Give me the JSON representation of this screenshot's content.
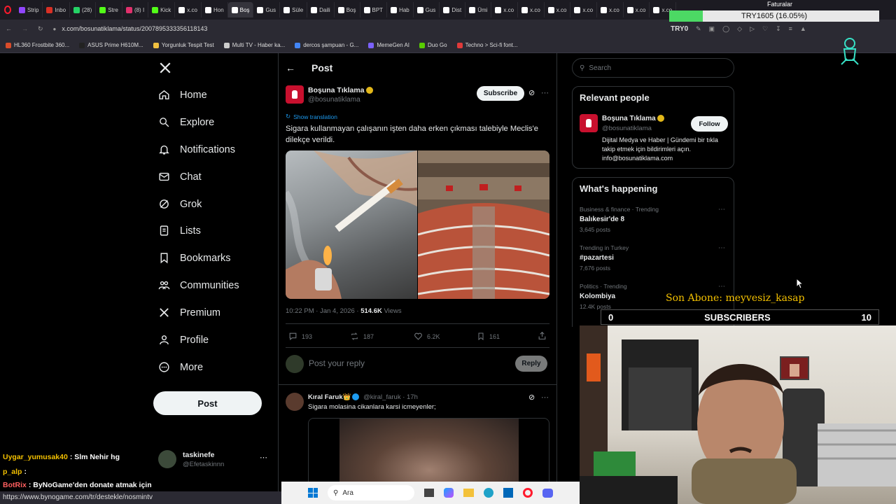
{
  "browser": {
    "tabs": [
      {
        "label": "Strip",
        "color": "#9146ff"
      },
      {
        "label": "Inbo",
        "color": "#d93025"
      },
      {
        "label": "(28)",
        "color": "#25d366"
      },
      {
        "label": "Stre",
        "color": "#53fc18"
      },
      {
        "label": "(8) I",
        "color": "#e1306c"
      },
      {
        "label": "Kick",
        "color": "#53fc18"
      },
      {
        "label": "x.co",
        "color": "#ffffff"
      },
      {
        "label": "Hon",
        "color": "#ffffff"
      },
      {
        "label": "Boş",
        "color": "#ffffff"
      },
      {
        "label": "Gus",
        "color": "#ffffff"
      },
      {
        "label": "Süle",
        "color": "#ffffff"
      },
      {
        "label": "Daili",
        "color": "#ffffff"
      },
      {
        "label": "Boş",
        "color": "#ffffff"
      },
      {
        "label": "BPT",
        "color": "#ffffff"
      },
      {
        "label": "Hab",
        "color": "#ffffff"
      },
      {
        "label": "Gus",
        "color": "#ffffff"
      },
      {
        "label": "Dist",
        "color": "#ffffff"
      },
      {
        "label": "Ümi",
        "color": "#ffffff"
      },
      {
        "label": "x.co",
        "color": "#ffffff"
      },
      {
        "label": "x.co",
        "color": "#ffffff"
      },
      {
        "label": "x.co",
        "color": "#ffffff"
      },
      {
        "label": "x.co",
        "color": "#ffffff"
      },
      {
        "label": "x.co",
        "color": "#ffffff"
      },
      {
        "label": "x.co",
        "color": "#ffffff"
      },
      {
        "label": "x.co",
        "color": "#ffffff"
      }
    ],
    "url": "x.com/bosunatiklama/status/2007895333356118143",
    "ext_label": "TRY0",
    "bookmarks": [
      {
        "label": "HL360 Frostbite 360...",
        "color": "#d94c2a"
      },
      {
        "label": "ASUS Prime H610M...",
        "color": "#222222"
      },
      {
        "label": "Yorgunluk Tespit Test",
        "color": "#f0c040"
      },
      {
        "label": "Multi TV - Haber ka...",
        "color": "#cccccc"
      },
      {
        "label": "dercos şampuan - G...",
        "color": "#4285f4"
      },
      {
        "label": "MemeGen AI",
        "color": "#7b61ff"
      },
      {
        "label": "Duo Go",
        "color": "#58cc02"
      },
      {
        "label": "Techno > Sci-fi font...",
        "color": "#e03a3a"
      }
    ]
  },
  "overlay": {
    "top_bar_label": "TRY1605 (16.05%)",
    "faturalar": "Faturalar",
    "son_abone": "Son Abone: meyvesiz_kasap",
    "subscribers_label": "SUBSCRIBERS",
    "subs_left": "0",
    "subs_right": "10",
    "chat": [
      {
        "user": "Uygar_yumusak40",
        "text": ": Slm Nehir hg",
        "color": "#f3c000"
      },
      {
        "user": "p_alp",
        "text": ":",
        "color": "#f3c000"
      },
      {
        "user": "BotRix",
        "text": ": ByNoGame'den donate atmak için",
        "color": "#ff5f5f"
      }
    ],
    "status_url": "https://www.bynogame.com/tr/destekle/nosmintv",
    "taskbar_search": "Ara"
  },
  "nav": {
    "items": [
      {
        "label": "Home",
        "icon": "home-icon"
      },
      {
        "label": "Explore",
        "icon": "search-icon"
      },
      {
        "label": "Notifications",
        "icon": "bell-icon"
      },
      {
        "label": "Chat",
        "icon": "mail-icon"
      },
      {
        "label": "Grok",
        "icon": "grok-icon"
      },
      {
        "label": "Lists",
        "icon": "list-icon"
      },
      {
        "label": "Bookmarks",
        "icon": "bookmark-icon"
      },
      {
        "label": "Communities",
        "icon": "people-icon"
      },
      {
        "label": "Premium",
        "icon": "x-icon"
      },
      {
        "label": "Profile",
        "icon": "person-icon"
      },
      {
        "label": "More",
        "icon": "more-circle-icon"
      }
    ],
    "post_button": "Post",
    "account": {
      "name": "taskinefe",
      "handle": "@Efetaskinnn"
    }
  },
  "post": {
    "header": "Post",
    "author": "Boşuna Tıklama",
    "handle": "@bosunatiklama",
    "subscribe": "Subscribe",
    "show_translation": "Show translation",
    "text": "Sigara kullanmayan çalışanın işten daha erken çıkması talebiyle Meclis'e dilekçe verildi.",
    "time": "10:22 PM · Jan 4, 2026 · ",
    "views_count": "514.6K",
    "views_label": " Views",
    "stats": {
      "replies": "193",
      "reposts": "187",
      "likes": "6.2K",
      "bookmarks": "161"
    },
    "reply_placeholder": "Post your reply",
    "reply_button": "Reply"
  },
  "reply": {
    "author": "Kıral Faruk👑",
    "handle": "@kiral_faruk",
    "time": "· 17h",
    "text": "Sigara molasina cikanlara karsi icmeyenler;"
  },
  "sidebar": {
    "search_placeholder": "Search",
    "relevant_title": "Relevant people",
    "person": {
      "name": "Boşuna Tıklama",
      "handle": "@bosunatiklama",
      "follow": "Follow",
      "bio": "Dijital Medya ve Haber | Gündemi bir tıkla takip etmek için bildirimleri açın. info@bosunatiklama.com"
    },
    "happening_title": "What's happening",
    "trends": [
      {
        "context": "Business & finance · Trending",
        "name": "Balıkesir'de 8",
        "posts": "3,645 posts"
      },
      {
        "context": "Trending in Turkey",
        "name": "#pazartesi",
        "posts": "7,676 posts"
      },
      {
        "context": "Politics · Trending",
        "name": "Kolombiya",
        "posts": "12.4K posts"
      }
    ]
  },
  "colors": {
    "accent": "#1d9bf0",
    "brand_red": "#c8102e",
    "overlay_yellow": "#f3c000"
  }
}
